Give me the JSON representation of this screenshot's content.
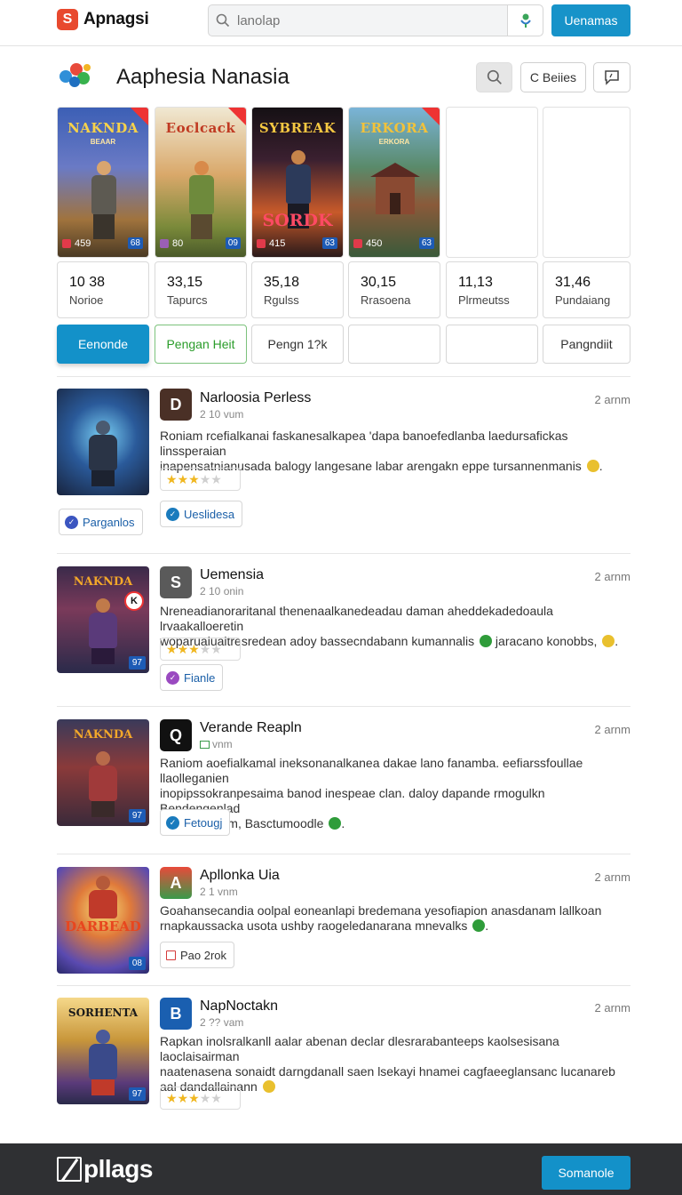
{
  "topbar": {
    "logo_text": "Apnagsi",
    "search_placeholder": "lanolap",
    "cta_label": "Uenamas"
  },
  "header": {
    "title": "Aaphesia Nanasia",
    "beles_label": "C Beiies"
  },
  "tiles": [
    {
      "title": "NAKNDA",
      "subtitle": "BEAAR",
      "stat_left": "459",
      "stat_right": "68",
      "bg": "#5a4f9a"
    },
    {
      "title": "Eoclcack",
      "subtitle": "",
      "stat_left": "80",
      "stat_right": "09",
      "bg": "#8a6a3b"
    },
    {
      "title": "SYBREAK",
      "subtitle": "",
      "big_text": "SORDK",
      "stat_left": "415",
      "stat_right": "63",
      "bg": "#3a2230"
    },
    {
      "title": "ERKORA",
      "subtitle": "ERKORA",
      "stat_left": "450",
      "stat_right": "63",
      "bg": "#3f6a5a"
    }
  ],
  "stats": [
    {
      "value": "10 38",
      "label": "Norioe"
    },
    {
      "value": "33,15",
      "label": "Tapurcs"
    },
    {
      "value": "35,18",
      "label": "Rgulss"
    },
    {
      "value": "30,15",
      "label": "Rrasoena"
    },
    {
      "value": "11,13",
      "label": "Plrmeutss"
    },
    {
      "value": "31,46",
      "label": "Pundaiang"
    }
  ],
  "filters": [
    "Eenonde",
    "Pengan Heit",
    "Pengn 1?k",
    "",
    "",
    "Pangndiit"
  ],
  "posts": [
    {
      "name": "Narloosia Perless",
      "sub": "2 10 vum",
      "time": "2 arnm",
      "text_lines": [
        "Roniam rcefialkanai faskanesalkapea 'dapa banoefedlanba laedursafickas linssperaian",
        "inapensatnianusada balogy langesane labar arengakn eppe tursannenmanis"
      ],
      "rating": 3,
      "tags": [
        "Parganlos",
        "Ueslidesa"
      ],
      "avatar": "D"
    },
    {
      "name": "Uemensia",
      "sub": "2 10 onin",
      "time": "2 arnm",
      "text_lines": [
        "Nreneadianoraritanal thenenaalkanedeadau daman aheddekadedoaula lrvaakalloeretin",
        "woparuaiuaitresredean adoy bassecndabann kumannalis",
        "jaracano konobbs,"
      ],
      "rating": 3,
      "tags": [
        "Fianle"
      ],
      "avatar": "S",
      "thumb_badge": "97",
      "thumb_mark": "K"
    },
    {
      "name": "Verande Reapln",
      "sub": "vnm",
      "time": "2 arnm",
      "text_lines": [
        "Raniom aoefialkamal ineksonanalkanea  dakae lano fanamba. eefiarssfoullae llaolleganien",
        "inopipssokranpesaima banod inespeae clan. daloy dapande rmogulkn Bendengenlad",
        "ldap deeimam, Basctumoodle"
      ],
      "tags": [
        "Fetougj"
      ],
      "avatar": "Q",
      "thumb_badge": "97"
    },
    {
      "name": "Apllonka Uia",
      "sub": "2 1 vnm",
      "time": "2 arnm",
      "text_lines": [
        "Goahansecandia oolpal eoneanlapi bredemana yesofiapion anasdanam lallkoan",
        "rnapkaussacka usota ushby raogeledanarana mnevalks"
      ],
      "tags": [
        "Pao 2rok"
      ],
      "avatar": "A",
      "thumb_title": "DARBEAD",
      "thumb_badge": "08"
    },
    {
      "name": "NapNoctakn",
      "sub": "2 ?? vam",
      "time": "2 arnm",
      "text_lines": [
        "Rapkan inolsralkanll aalar abenan declar dlesrarabanteeps kaolsesisana laoclaisairman",
        "naatenasena sonaidt darngdanall saen lsekayi hnamei cagfaeeglansanc lucanareb",
        "aal dandallainann"
      ],
      "rating": 3,
      "tags": [],
      "avatar": "B",
      "thumb_title": "SORHENTA",
      "thumb_badge": "97"
    }
  ],
  "footer": {
    "logo_text": "pllags",
    "cta_label": "Somanole"
  },
  "colors": {
    "accent": "#1391c9",
    "footer_bg": "#2f3033"
  }
}
